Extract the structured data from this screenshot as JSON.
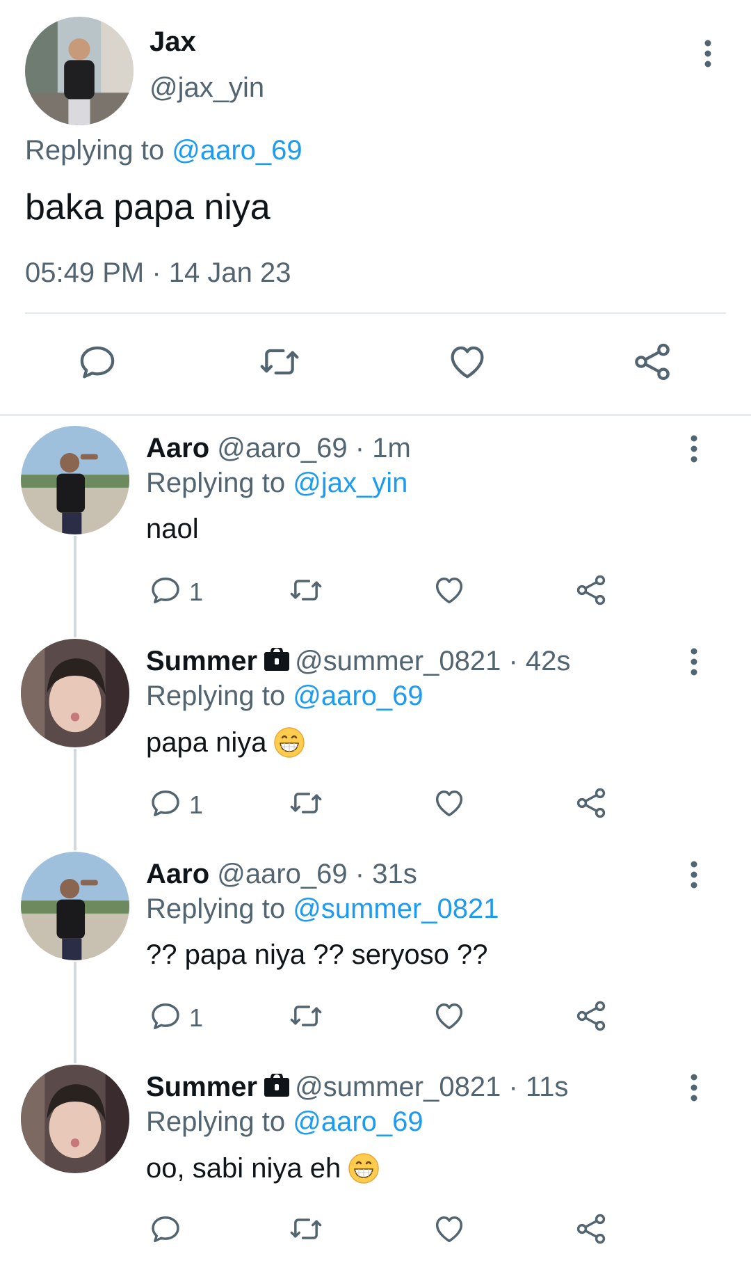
{
  "colors": {
    "link": "#1d9bf0",
    "secondary": "#536471",
    "primary": "#0f1419",
    "icon": "#536471"
  },
  "main_tweet": {
    "name": "Jax",
    "handle": "@jax_yin",
    "replying_label": "Replying to",
    "replying_to": "@aaro_69",
    "text": "baka papa niya",
    "timestamp": "05:49 PM · 14 Jan 23",
    "actions": [
      "reply-icon",
      "retweet-icon",
      "like-icon",
      "share-icon"
    ]
  },
  "replies": [
    {
      "name": "Aaro",
      "handle": "@aaro_69",
      "sep": " · ",
      "time": "1m",
      "replying_label": "Replying to",
      "replying_to": "@jax_yin",
      "text": "naol",
      "reply_count": "1",
      "locked": false,
      "emoji": ""
    },
    {
      "name": "Summer",
      "handle": "@summer_0821",
      "sep": " · ",
      "time": "42s",
      "replying_label": "Replying to",
      "replying_to": "@aaro_69",
      "text": "papa niya",
      "reply_count": "1",
      "locked": true,
      "emoji": "grinning-face"
    },
    {
      "name": "Aaro",
      "handle": "@aaro_69",
      "sep": " · ",
      "time": "31s",
      "replying_label": "Replying to",
      "replying_to": "@summer_0821",
      "text": "?? papa niya ?? seryoso ??",
      "reply_count": "1",
      "locked": false,
      "emoji": ""
    },
    {
      "name": "Summer",
      "handle": "@summer_0821",
      "sep": " · ",
      "time": "11s",
      "replying_label": "Replying to",
      "replying_to": "@aaro_69",
      "text": "oo, sabi niya eh",
      "reply_count": "",
      "locked": true,
      "emoji": "grinning-face"
    }
  ]
}
